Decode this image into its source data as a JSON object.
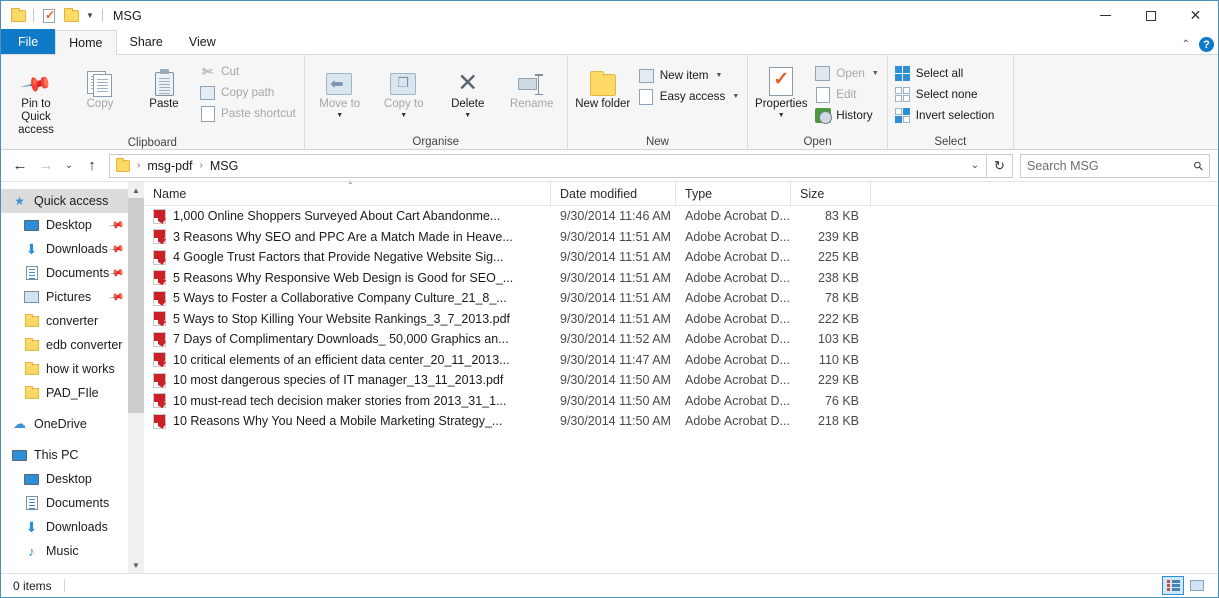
{
  "window": {
    "title": "MSG",
    "quick_access_icons": [
      "folder-icon",
      "save-check-icon",
      "folder-icon"
    ],
    "controls": {
      "minimize": "—",
      "maximize": "□",
      "close": "✕"
    }
  },
  "ribbon": {
    "tabs": [
      {
        "label": "File",
        "id": "file",
        "active": false
      },
      {
        "label": "Home",
        "id": "home",
        "active": true
      },
      {
        "label": "Share",
        "id": "share",
        "active": false
      },
      {
        "label": "View",
        "id": "view",
        "active": false
      }
    ],
    "collapse_chevron": "⌃",
    "help_label": "?",
    "groups": [
      {
        "label": "Clipboard",
        "big_buttons": [
          {
            "label": "Pin to Quick access",
            "icon": "pin-icon",
            "disabled": false
          },
          {
            "label": "Copy",
            "icon": "copy-icon",
            "disabled": true
          },
          {
            "label": "Paste",
            "icon": "paste-icon",
            "disabled": false
          }
        ],
        "small_buttons": [
          {
            "label": "Cut",
            "icon": "scissors-icon",
            "disabled": true
          },
          {
            "label": "Copy path",
            "icon": "copy-path-icon",
            "disabled": true
          },
          {
            "label": "Paste shortcut",
            "icon": "paste-shortcut-icon",
            "disabled": true
          }
        ]
      },
      {
        "label": "Organise",
        "big_buttons": [
          {
            "label": "Move to",
            "icon": "move-to-icon",
            "disabled": true,
            "caret": true
          },
          {
            "label": "Copy to",
            "icon": "copy-to-icon",
            "disabled": true,
            "caret": true
          },
          {
            "label": "Delete",
            "icon": "delete-x-icon",
            "disabled": false,
            "caret": true
          },
          {
            "label": "Rename",
            "icon": "rename-icon",
            "disabled": true
          }
        ]
      },
      {
        "label": "New",
        "big_buttons": [
          {
            "label": "New folder",
            "icon": "new-folder-icon",
            "disabled": false
          }
        ],
        "small_buttons": [
          {
            "label": "New item",
            "icon": "new-item-icon",
            "caret": true
          },
          {
            "label": "Easy access",
            "icon": "easy-access-icon",
            "caret": true
          }
        ]
      },
      {
        "label": "Open",
        "big_buttons": [
          {
            "label": "Properties",
            "icon": "properties-icon",
            "disabled": false,
            "caret": true
          }
        ],
        "small_buttons": [
          {
            "label": "Open",
            "icon": "open-icon",
            "disabled": true,
            "caret": true
          },
          {
            "label": "Edit",
            "icon": "edit-icon",
            "disabled": true
          },
          {
            "label": "History",
            "icon": "history-icon",
            "disabled": false
          }
        ]
      },
      {
        "label": "Select",
        "small_buttons": [
          {
            "label": "Select all",
            "icon": "select-all-icon"
          },
          {
            "label": "Select none",
            "icon": "select-none-icon"
          },
          {
            "label": "Invert selection",
            "icon": "invert-selection-icon"
          }
        ]
      }
    ]
  },
  "addressbar": {
    "back": "←",
    "forward": "→",
    "recent": "⌄",
    "up": "↑",
    "breadcrumbs": [
      "msg-pdf",
      "MSG"
    ],
    "separator": "›",
    "dropdown_chevron": "⌄",
    "refresh": "↻",
    "search": {
      "placeholder": "Search MSG",
      "value": "",
      "icon": "search-icon"
    }
  },
  "navpane": {
    "items": [
      {
        "label": "Quick access",
        "icon": "star-icon",
        "indent": 0,
        "selected": true,
        "pinned": false
      },
      {
        "label": "Desktop",
        "icon": "monitor-icon",
        "indent": 1,
        "selected": false,
        "pinned": true
      },
      {
        "label": "Downloads",
        "icon": "download-arrow-icon",
        "indent": 1,
        "selected": false,
        "pinned": true
      },
      {
        "label": "Documents",
        "icon": "document-icon",
        "indent": 1,
        "selected": false,
        "pinned": true
      },
      {
        "label": "Pictures",
        "icon": "picture-icon",
        "indent": 1,
        "selected": false,
        "pinned": true
      },
      {
        "label": "converter",
        "icon": "folder-icon",
        "indent": 1,
        "selected": false,
        "pinned": false
      },
      {
        "label": "edb converter",
        "icon": "folder-icon",
        "indent": 1,
        "selected": false,
        "pinned": false
      },
      {
        "label": "how it works",
        "icon": "folder-icon",
        "indent": 1,
        "selected": false,
        "pinned": false
      },
      {
        "label": "PAD_FIle",
        "icon": "folder-icon",
        "indent": 1,
        "selected": false,
        "pinned": false
      },
      {
        "label": "OneDrive",
        "icon": "cloud-icon",
        "indent": 0,
        "selected": false,
        "pinned": false
      },
      {
        "label": "This PC",
        "icon": "this-pc-icon",
        "indent": 0,
        "selected": false,
        "pinned": false
      },
      {
        "label": "Desktop",
        "icon": "monitor-icon",
        "indent": 1,
        "selected": false,
        "pinned": false
      },
      {
        "label": "Documents",
        "icon": "document-icon",
        "indent": 1,
        "selected": false,
        "pinned": false
      },
      {
        "label": "Downloads",
        "icon": "download-arrow-icon",
        "indent": 1,
        "selected": false,
        "pinned": false
      },
      {
        "label": "Music",
        "icon": "music-note-icon",
        "indent": 1,
        "selected": false,
        "pinned": false
      }
    ]
  },
  "filelist": {
    "columns": [
      {
        "label": "Name",
        "sorted": true,
        "sort_glyph": "⌃"
      },
      {
        "label": "Date modified",
        "sorted": false
      },
      {
        "label": "Type",
        "sorted": false
      },
      {
        "label": "Size",
        "sorted": false
      }
    ],
    "rows": [
      {
        "name": "1,000 Online Shoppers Surveyed About Cart Abandonme...",
        "date": "9/30/2014 11:46 AM",
        "type": "Adobe Acrobat D...",
        "size": "83 KB",
        "icon": "pdf-icon"
      },
      {
        "name": "3 Reasons Why SEO and PPC Are a Match Made in Heave...",
        "date": "9/30/2014 11:51 AM",
        "type": "Adobe Acrobat D...",
        "size": "239 KB",
        "icon": "pdf-icon"
      },
      {
        "name": "4 Google Trust Factors that Provide Negative Website Sig...",
        "date": "9/30/2014 11:51 AM",
        "type": "Adobe Acrobat D...",
        "size": "225 KB",
        "icon": "pdf-icon"
      },
      {
        "name": "5 Reasons Why Responsive Web Design is Good for SEO_...",
        "date": "9/30/2014 11:51 AM",
        "type": "Adobe Acrobat D...",
        "size": "238 KB",
        "icon": "pdf-icon"
      },
      {
        "name": "5 Ways to Foster a Collaborative Company Culture_21_8_...",
        "date": "9/30/2014 11:51 AM",
        "type": "Adobe Acrobat D...",
        "size": "78 KB",
        "icon": "pdf-icon"
      },
      {
        "name": "5 Ways to Stop Killing Your Website Rankings_3_7_2013.pdf",
        "date": "9/30/2014 11:51 AM",
        "type": "Adobe Acrobat D...",
        "size": "222 KB",
        "icon": "pdf-icon"
      },
      {
        "name": "7 Days of Complimentary Downloads_ 50,000 Graphics an...",
        "date": "9/30/2014 11:52 AM",
        "type": "Adobe Acrobat D...",
        "size": "103 KB",
        "icon": "pdf-icon"
      },
      {
        "name": "10 critical elements of an efficient data center_20_11_2013...",
        "date": "9/30/2014 11:47 AM",
        "type": "Adobe Acrobat D...",
        "size": "110 KB",
        "icon": "pdf-icon"
      },
      {
        "name": "10 most dangerous species of IT manager_13_11_2013.pdf",
        "date": "9/30/2014 11:50 AM",
        "type": "Adobe Acrobat D...",
        "size": "229 KB",
        "icon": "pdf-icon"
      },
      {
        "name": "10 must-read tech decision maker stories from 2013_31_1...",
        "date": "9/30/2014 11:50 AM",
        "type": "Adobe Acrobat D...",
        "size": "76 KB",
        "icon": "pdf-icon"
      },
      {
        "name": "10 Reasons Why You Need a Mobile Marketing Strategy_...",
        "date": "9/30/2014 11:50 AM",
        "type": "Adobe Acrobat D...",
        "size": "218 KB",
        "icon": "pdf-icon"
      }
    ]
  },
  "statusbar": {
    "item_count": "0 items",
    "views": [
      {
        "name": "details-view",
        "active": true
      },
      {
        "name": "large-icons-view",
        "active": false
      }
    ]
  },
  "colors": {
    "accent": "#0f7ac7",
    "ribbon_bg": "#f6f6f6",
    "selection": "#dcdcdc",
    "pdf_red": "#cc2027",
    "folder_yellow": "#ffd966",
    "window_border": "#4a90b8"
  }
}
